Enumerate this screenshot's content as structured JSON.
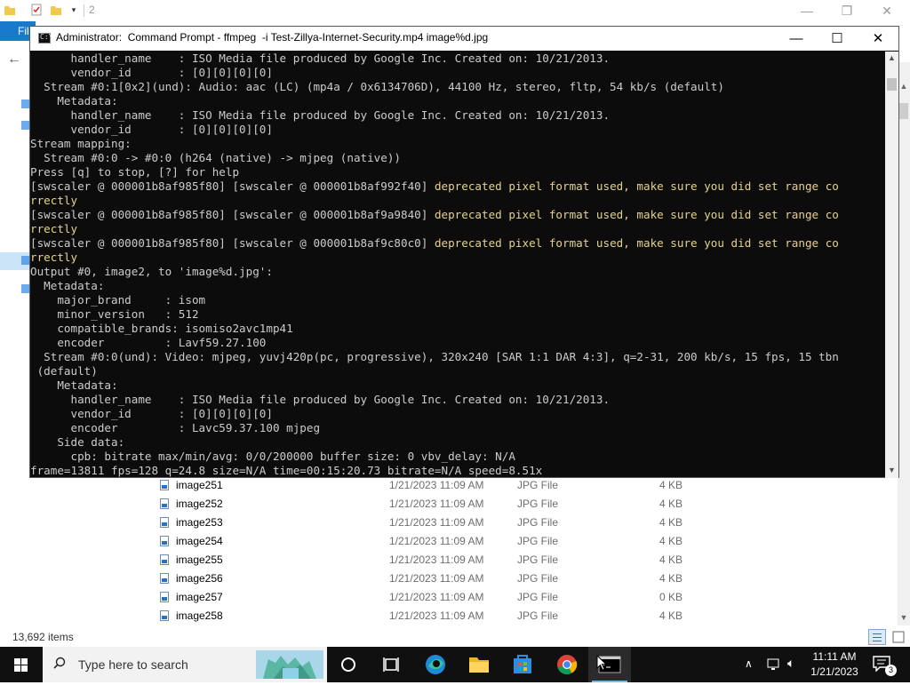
{
  "explorer": {
    "title_fragment": "2",
    "file_tab": "File",
    "status_items": "13,692 items",
    "files": [
      {
        "name": "image251",
        "date": "1/21/2023 11:09 AM",
        "type": "JPG File",
        "size": "4 KB"
      },
      {
        "name": "image252",
        "date": "1/21/2023 11:09 AM",
        "type": "JPG File",
        "size": "4 KB"
      },
      {
        "name": "image253",
        "date": "1/21/2023 11:09 AM",
        "type": "JPG File",
        "size": "4 KB"
      },
      {
        "name": "image254",
        "date": "1/21/2023 11:09 AM",
        "type": "JPG File",
        "size": "4 KB"
      },
      {
        "name": "image255",
        "date": "1/21/2023 11:09 AM",
        "type": "JPG File",
        "size": "4 KB"
      },
      {
        "name": "image256",
        "date": "1/21/2023 11:09 AM",
        "type": "JPG File",
        "size": "4 KB"
      },
      {
        "name": "image257",
        "date": "1/21/2023 11:09 AM",
        "type": "JPG File",
        "size": "0 KB"
      },
      {
        "name": "image258",
        "date": "1/21/2023 11:09 AM",
        "type": "JPG File",
        "size": "4 KB"
      }
    ]
  },
  "cmd": {
    "title": "Administrator:  Command Prompt - ffmpeg  -i Test-Zillya-Internet-Security.mp4 image%d.jpg",
    "lines": [
      {
        "text": "      handler_name    : ISO Media file produced by Google Inc. Created on: 10/21/2013.",
        "color": "normal"
      },
      {
        "text": "      vendor_id       : [0][0][0][0]",
        "color": "normal"
      },
      {
        "text": "  Stream #0:1[0x2](und): Audio: aac (LC) (mp4a / 0x6134706D), 44100 Hz, stereo, fltp, 54 kb/s (default)",
        "color": "normal"
      },
      {
        "text": "    Metadata:",
        "color": "normal"
      },
      {
        "text": "      handler_name    : ISO Media file produced by Google Inc. Created on: 10/21/2013.",
        "color": "normal"
      },
      {
        "text": "      vendor_id       : [0][0][0][0]",
        "color": "normal"
      },
      {
        "text": "Stream mapping:",
        "color": "normal"
      },
      {
        "text": "  Stream #0:0 -> #0:0 (h264 (native) -> mjpeg (native))",
        "color": "normal"
      },
      {
        "text": "Press [q] to stop, [?] for help",
        "color": "normal"
      },
      {
        "text": "[swscaler @ 000001b8af985f80] [swscaler @ 000001b8af992f40] ",
        "warn": "deprecated pixel format used, make sure you did set range co",
        "color": "mixed"
      },
      {
        "text": "rrectly",
        "color": "warn"
      },
      {
        "text": "[swscaler @ 000001b8af985f80] [swscaler @ 000001b8af9a9840] ",
        "warn": "deprecated pixel format used, make sure you did set range co",
        "color": "mixed"
      },
      {
        "text": "rrectly",
        "color": "warn"
      },
      {
        "text": "[swscaler @ 000001b8af985f80] [swscaler @ 000001b8af9c80c0] ",
        "warn": "deprecated pixel format used, make sure you did set range co",
        "color": "mixed"
      },
      {
        "text": "rrectly",
        "color": "warn"
      },
      {
        "text": "Output #0, image2, to 'image%d.jpg':",
        "color": "normal"
      },
      {
        "text": "  Metadata:",
        "color": "normal"
      },
      {
        "text": "    major_brand     : isom",
        "color": "normal"
      },
      {
        "text": "    minor_version   : 512",
        "color": "normal"
      },
      {
        "text": "    compatible_brands: isomiso2avc1mp41",
        "color": "normal"
      },
      {
        "text": "    encoder         : Lavf59.27.100",
        "color": "normal"
      },
      {
        "text": "  Stream #0:0(und): Video: mjpeg, yuvj420p(pc, progressive), 320x240 [SAR 1:1 DAR 4:3], q=2-31, 200 kb/s, 15 fps, 15 tbn",
        "color": "normal"
      },
      {
        "text": " (default)",
        "color": "normal"
      },
      {
        "text": "    Metadata:",
        "color": "normal"
      },
      {
        "text": "      handler_name    : ISO Media file produced by Google Inc. Created on: 10/21/2013.",
        "color": "normal"
      },
      {
        "text": "      vendor_id       : [0][0][0][0]",
        "color": "normal"
      },
      {
        "text": "      encoder         : Lavc59.37.100 mjpeg",
        "color": "normal"
      },
      {
        "text": "    Side data:",
        "color": "normal"
      },
      {
        "text": "      cpb: bitrate max/min/avg: 0/0/200000 buffer size: 0 vbv_delay: N/A",
        "color": "normal"
      },
      {
        "text": "frame=13811 fps=128 q=24.8 size=N/A time=00:15:20.73 bitrate=N/A speed=8.51x",
        "color": "normal"
      }
    ]
  },
  "taskbar": {
    "search_placeholder": "Type here to search",
    "time": "11:11 AM",
    "date": "1/21/2023",
    "notification_count": "3",
    "icons": [
      "windows-start-icon",
      "cortana-icon",
      "task-view-icon",
      "edge-icon",
      "file-explorer-icon",
      "store-icon",
      "chrome-icon",
      "command-prompt-icon"
    ]
  },
  "colors": {
    "console_bg": "#0c0c0c",
    "console_text": "#cccccc",
    "console_warning": "#e5d38a",
    "taskbar_bg": "#101010",
    "explorer_accent": "#1979ca"
  }
}
